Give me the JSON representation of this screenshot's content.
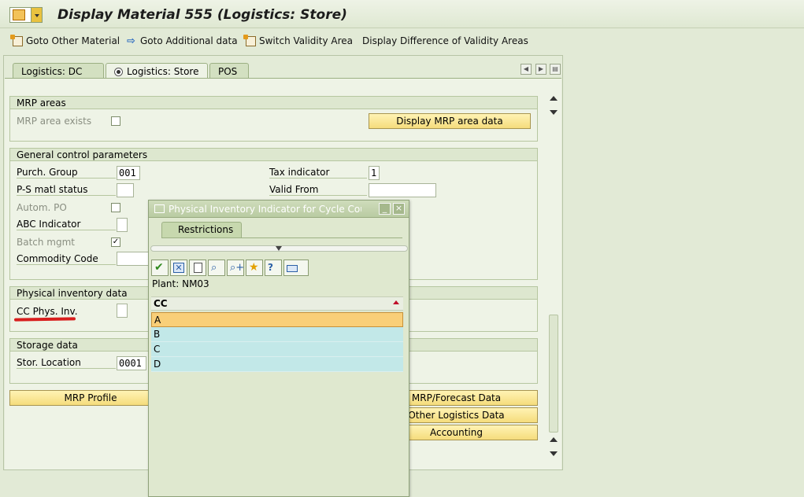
{
  "window": {
    "title": "Display Material 555 (Logistics: Store)"
  },
  "toolbar": {
    "items": [
      {
        "label": "Goto Other Material",
        "icon": "material-doc-icon"
      },
      {
        "label": "Goto Additional data",
        "icon": "arrow-right-icon"
      },
      {
        "label": "Switch Validity Area",
        "icon": "switch-doc-icon"
      },
      {
        "label": "Display Difference of Validity Areas",
        "icon": ""
      }
    ]
  },
  "tabs": [
    {
      "label": "Logistics: DC",
      "active": false
    },
    {
      "label": "Logistics: Store",
      "active": true
    },
    {
      "label": "POS",
      "active": false
    }
  ],
  "mrp_areas": {
    "title": "MRP areas",
    "exists_label": "MRP area exists",
    "exists_checked": false,
    "display_button": "Display MRP area data"
  },
  "general_control": {
    "title": "General control parameters",
    "purch_group_label": "Purch. Group",
    "purch_group_value": "001",
    "ps_status_label": "P-S matl status",
    "ps_status_value": "",
    "autom_po_label": "Autom. PO",
    "abc_label": "ABC Indicator",
    "batch_label": "Batch mgmt",
    "batch_checked": true,
    "commodity_label": "Commodity Code",
    "tax_label": "Tax indicator",
    "tax_value": "1",
    "valid_from_label": "Valid From",
    "valid_from_value": ""
  },
  "physical_inventory": {
    "title": "Physical inventory data",
    "cc_label": "CC Phys. Inv.",
    "cc_value": ""
  },
  "storage": {
    "title": "Storage data",
    "location_label": "Stor. Location",
    "location_value": "0001"
  },
  "bottom_buttons": {
    "mrp_profile": "MRP Profile",
    "mrp_forecast": "MRP/Forecast Data",
    "other_logistics": "Other Logistics Data",
    "accounting": "Accounting"
  },
  "popup": {
    "title": "Physical Inventory Indicator for Cycle Cou...",
    "tab_label": "Restrictions",
    "plant_line": "Plant: NM03",
    "column_header": "CC",
    "rows": [
      "A",
      "B",
      "C",
      "D"
    ],
    "selected_row": "A",
    "toolbar_icons": [
      "check-icon",
      "cancel-icon",
      "new-doc-icon",
      "find-icon",
      "find-next-icon",
      "favorite-add-icon",
      "help-icon",
      "print-icon"
    ]
  },
  "colors": {
    "background": "#e2ead6",
    "button_yellow": "#f5dc7c",
    "selected_row": "#f9cf78",
    "list_row": "#c2e8e8",
    "annotation_red": "#d81e1e"
  }
}
